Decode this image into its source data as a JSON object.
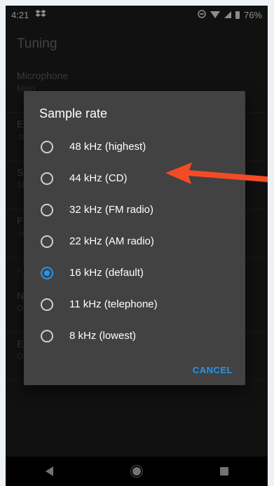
{
  "status_bar": {
    "time": "4:21",
    "notification_icon": "dropbox-icon",
    "battery_percent": "76%"
  },
  "app": {
    "title": "Tuning"
  },
  "settings_list": {
    "items": [
      {
        "title": "Microphone",
        "summary": "Main"
      },
      {
        "title": "E",
        "summary": ".n"
      },
      {
        "title": "S",
        "summary": "16"
      },
      {
        "title": "F",
        "summary": ".n"
      }
    ],
    "section_header": "F",
    "items_after": [
      {
        "title": "N",
        "summary": "O"
      },
      {
        "title": "E",
        "summary": "O"
      }
    ]
  },
  "dialog": {
    "title": "Sample rate",
    "options": [
      {
        "label": "48 kHz (highest)",
        "checked": false
      },
      {
        "label": "44 kHz (CD)",
        "checked": false
      },
      {
        "label": "32 kHz (FM radio)",
        "checked": false
      },
      {
        "label": "22 kHz (AM radio)",
        "checked": false
      },
      {
        "label": "16 kHz (default)",
        "checked": true
      },
      {
        "label": "11 kHz (telephone)",
        "checked": false
      },
      {
        "label": "8 kHz (lowest)",
        "checked": false
      }
    ],
    "cancel_label": "CANCEL"
  },
  "annotation": {
    "arrow_color": "#f44b27",
    "points_to": "44 kHz (CD)"
  },
  "colors": {
    "accent": "#2196f3",
    "dialog_bg": "#424242"
  }
}
